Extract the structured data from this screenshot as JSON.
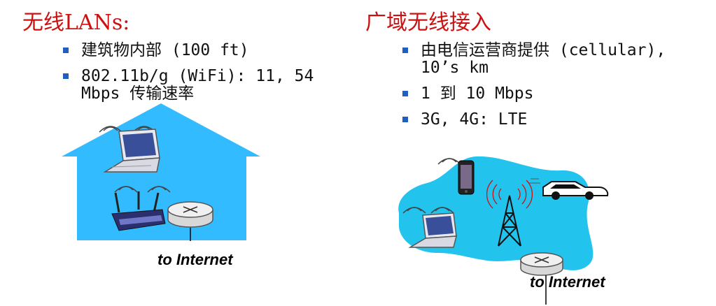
{
  "left": {
    "title": "无线LANs:",
    "bullets": [
      "建筑物内部 (100 ft)",
      "802.11b/g (WiFi): 11, 54 Mbps 传输速率"
    ],
    "caption": "to Internet"
  },
  "right": {
    "title": "广域无线接入",
    "bullets": [
      "由电信运营商提供 (cellular), 10’s km",
      "1 到 10 Mbps",
      "3G, 4G:  LTE"
    ],
    "caption": "to Internet"
  },
  "colors": {
    "title": "#cc1111",
    "bullet": "#1f5fbf",
    "house": "#33bbff",
    "cloud": "#22c4ee"
  },
  "icons": [
    "wifi-waves-icon",
    "laptop-icon",
    "wireless-router-icon",
    "router-icon",
    "cellphone-icon",
    "car-icon",
    "cell-tower-icon"
  ]
}
